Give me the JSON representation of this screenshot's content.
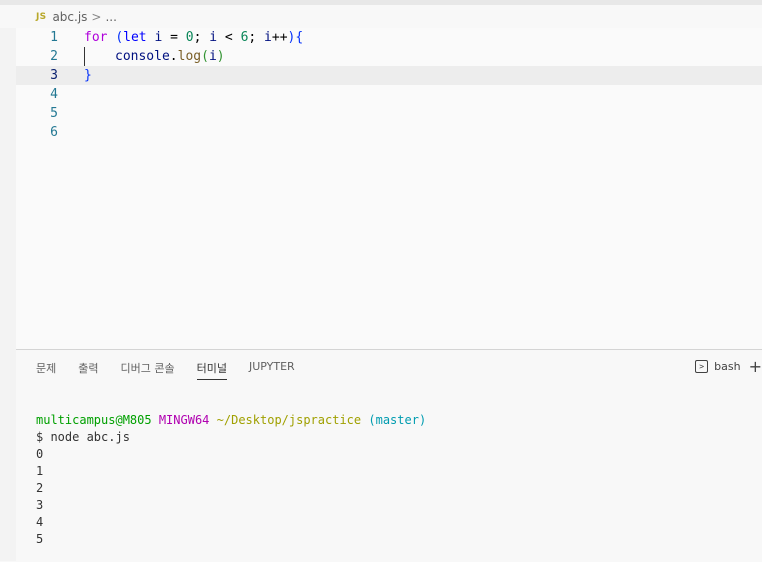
{
  "breadcrumb": {
    "file_icon": "JS",
    "filename": "abc.js",
    "separator": ">",
    "ellipsis": "..."
  },
  "editor": {
    "line_numbers": [
      "1",
      "2",
      "3",
      "4",
      "5",
      "6"
    ],
    "code": {
      "l1": {
        "for": "for",
        "open_paren": "(",
        "let": "let",
        "i1": "i",
        "eq": "=",
        "zero": "0",
        "semi1": ";",
        "i2": "i",
        "lt": "<",
        "six": "6",
        "semi2": ";",
        "i3": "i",
        "incr": "++",
        "close_paren": ")",
        "brace_open": "{"
      },
      "l2": {
        "console": "console",
        "dot": ".",
        "log": "log",
        "paren_open": "(",
        "arg": "i",
        "paren_close": ")"
      },
      "l3": {
        "brace_close": "}"
      }
    }
  },
  "panel": {
    "tabs": [
      "문제",
      "출력",
      "디버그 콘솔",
      "터미널",
      "JUPYTER"
    ],
    "active_tab": "터미널",
    "terminal_name": "bash",
    "terminal_icon": "terminal-icon",
    "add_icon": "plus-icon",
    "add_glyph": "+"
  },
  "terminal": {
    "prompt_user": "multicampus@M805",
    "prompt_host": "MINGW64",
    "prompt_path": "~/Desktop/jspractice",
    "prompt_branch": "(master)",
    "command": "$ node abc.js",
    "output": [
      "0",
      "1",
      "2",
      "3",
      "4",
      "5"
    ]
  }
}
